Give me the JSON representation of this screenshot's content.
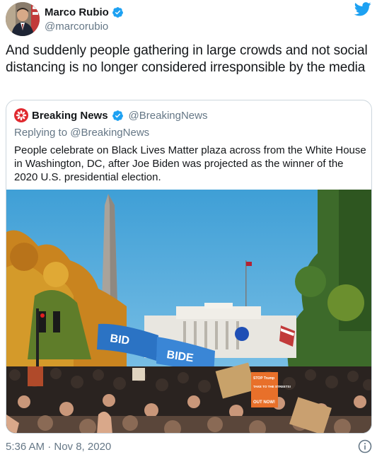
{
  "author": {
    "display_name": "Marco Rubio",
    "handle": "@marcorubio",
    "verified": true
  },
  "tweet": {
    "text": "And suddenly people gathering in large crowds and not social distancing is no longer considered irresponsible by the media",
    "timestamp": "5:36 AM · Nov 8, 2020"
  },
  "quoted": {
    "display_name": "Breaking News",
    "handle": "@BreakingNews",
    "verified": true,
    "replying_to": "Replying to @BreakingNews",
    "text": "People celebrate on Black Lives Matter plaza across from the White House in Washington, DC, after Joe Biden was projected as the winner of the 2020 U.S. presidential election.",
    "photo": {
      "flag_text_1": "BID",
      "flag_text_2": "BIDE",
      "sign_1": "STOP Trump",
      "sign_2": "TAKE TO THE STREETS!",
      "sign_3": "OUT NOW!"
    }
  },
  "icons": {
    "verified": "verified-badge-icon",
    "twitter": "twitter-bird-icon",
    "info": "info-icon",
    "news_logo": "breaking-news-logo"
  },
  "colors": {
    "twitter_blue": "#1da1f2",
    "text_primary": "#14171a",
    "text_secondary": "#657786",
    "border": "#ccd6dd",
    "news_red": "#e0282e"
  }
}
